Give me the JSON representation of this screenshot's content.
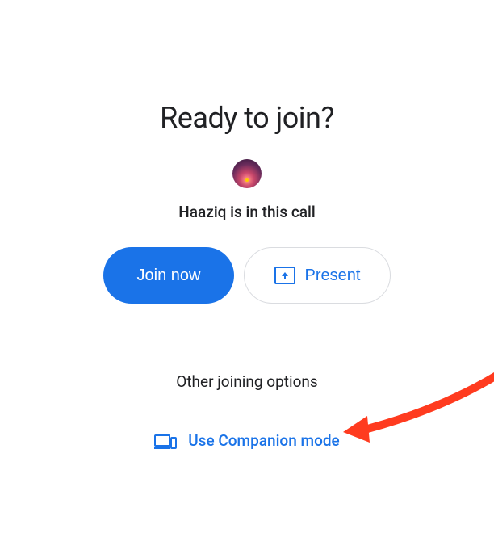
{
  "heading": "Ready to join?",
  "participant": {
    "name": "Haaziq",
    "status_text": "Haaziq is in this call"
  },
  "buttons": {
    "join": "Join now",
    "present": "Present"
  },
  "other_options_label": "Other joining options",
  "companion_mode_label": "Use Companion mode",
  "colors": {
    "primary": "#1a73e8",
    "text": "#202124",
    "border": "#dadce0",
    "annotation": "#ff3b1f"
  }
}
